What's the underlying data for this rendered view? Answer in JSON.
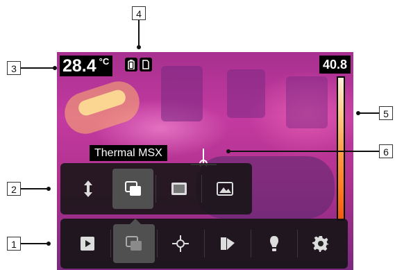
{
  "camera": {
    "temperature": "28.4",
    "temperature_unit": "°C",
    "scale_max": "40.8",
    "mode_label": "Thermal MSX",
    "status_icons": [
      "battery-icon",
      "sd-card-icon"
    ]
  },
  "submenu": {
    "items": [
      {
        "icon": "arrows-updown-icon",
        "active": false
      },
      {
        "icon": "msx-mode-icon",
        "active": true
      },
      {
        "icon": "thermal-mode-icon",
        "active": false
      },
      {
        "icon": "digital-camera-mode-icon",
        "active": false
      }
    ]
  },
  "main_menu": {
    "items": [
      {
        "icon": "play-icon",
        "active": false
      },
      {
        "icon": "image-mode-icon",
        "active": true
      },
      {
        "icon": "measurement-spot-icon",
        "active": false
      },
      {
        "icon": "color-palette-icon",
        "active": false
      },
      {
        "icon": "lamp-icon",
        "active": false
      },
      {
        "icon": "settings-gear-icon",
        "active": false
      }
    ]
  },
  "callouts": {
    "c1": "1",
    "c2": "2",
    "c3": "3",
    "c4": "4",
    "c5": "5",
    "c6": "6"
  },
  "colors": {
    "thermal_bg": "#b0318f",
    "overlay": "#141414",
    "active_button": "#505050",
    "scale_top": "#fff1dc",
    "scale_bottom": "#f05a12"
  }
}
